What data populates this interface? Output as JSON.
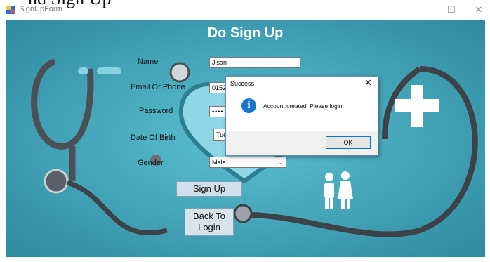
{
  "caption": "nd Sign Up",
  "window": {
    "title": "SignUpForm",
    "minimize_glyph": "—",
    "maximize_glyph": "☐",
    "close_glyph": "✕"
  },
  "form": {
    "heading": "Do Sign Up",
    "name_label": "Name",
    "name_value": "Jisan",
    "email_label": "Email Or Phone",
    "email_value": "0152",
    "password_label": "Password",
    "password_value": "••••",
    "dob_label": "Date Of Birth",
    "dob_value": "Tue",
    "gender_label": "Gender",
    "gender_value": "Male",
    "signup_button": "Sign Up",
    "back_button_line1": "Back To",
    "back_button_line2": "Login"
  },
  "dialog": {
    "title": "Success",
    "close_glyph": "✕",
    "icon": "info-icon",
    "icon_glyph": "i",
    "message": "Account created. Please login.",
    "ok_button": "OK"
  },
  "colors": {
    "background": "#3b9fb4",
    "info_blue": "#1a73d1",
    "ok_border": "#0078d7"
  }
}
